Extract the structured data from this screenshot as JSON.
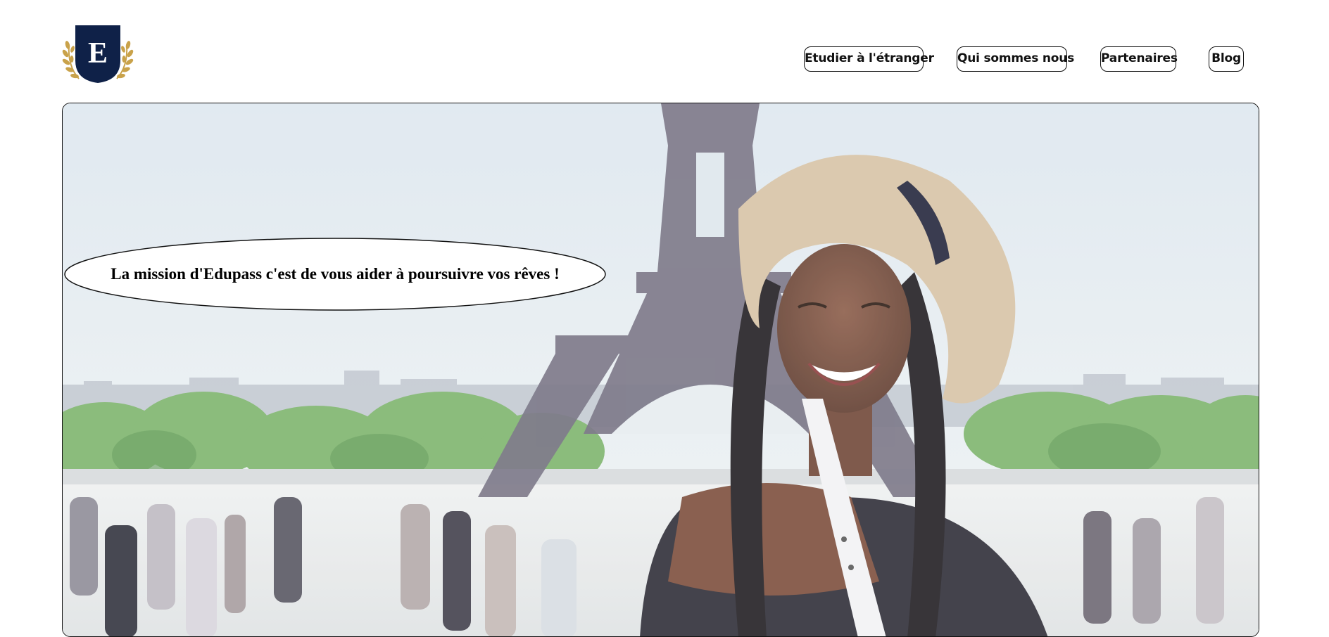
{
  "logo": {
    "letter": "E",
    "icon": "laurel-crest-icon",
    "colors": {
      "shield": "#0f2148",
      "laurel": "#c9a24a"
    }
  },
  "nav": {
    "items": [
      {
        "label": "Etudier à l'étranger"
      },
      {
        "label": "Qui sommes nous"
      },
      {
        "label": "Partenaires"
      },
      {
        "label": "Blog"
      }
    ]
  },
  "hero": {
    "mission_text": "La mission d'Edupass c'est de vous aider à poursuivre vos rêves !",
    "image": "woman-in-hat-laughing-at-eiffel-tower-photo"
  }
}
